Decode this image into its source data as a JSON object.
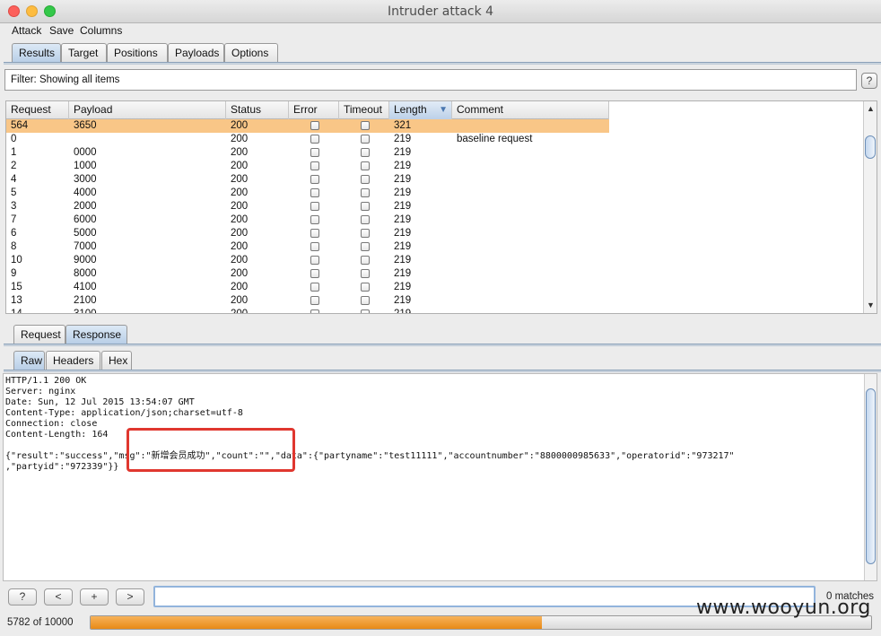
{
  "window": {
    "title": "Intruder attack 4"
  },
  "menu": [
    "Attack",
    "Save",
    "Columns"
  ],
  "main_tabs": [
    {
      "label": "Results",
      "active": true
    },
    {
      "label": "Target",
      "active": false
    },
    {
      "label": "Positions",
      "active": false
    },
    {
      "label": "Payloads",
      "active": false
    },
    {
      "label": "Options",
      "active": false
    }
  ],
  "filter": {
    "text": "Filter: Showing all items",
    "help_label": "?"
  },
  "results_table": {
    "columns": [
      "Request",
      "Payload",
      "Status",
      "Error",
      "Timeout",
      "Length",
      "Comment"
    ],
    "sorted_column": "Length",
    "sort_indicator": "▼",
    "rows": [
      {
        "request": "564",
        "payload": "3650",
        "status": "200",
        "length": "321",
        "comment": "",
        "selected": true
      },
      {
        "request": "0",
        "payload": "",
        "status": "200",
        "length": "219",
        "comment": "baseline request",
        "selected": false
      },
      {
        "request": "1",
        "payload": "0000",
        "status": "200",
        "length": "219",
        "comment": "",
        "selected": false
      },
      {
        "request": "2",
        "payload": "1000",
        "status": "200",
        "length": "219",
        "comment": "",
        "selected": false
      },
      {
        "request": "4",
        "payload": "3000",
        "status": "200",
        "length": "219",
        "comment": "",
        "selected": false
      },
      {
        "request": "5",
        "payload": "4000",
        "status": "200",
        "length": "219",
        "comment": "",
        "selected": false
      },
      {
        "request": "3",
        "payload": "2000",
        "status": "200",
        "length": "219",
        "comment": "",
        "selected": false
      },
      {
        "request": "7",
        "payload": "6000",
        "status": "200",
        "length": "219",
        "comment": "",
        "selected": false
      },
      {
        "request": "6",
        "payload": "5000",
        "status": "200",
        "length": "219",
        "comment": "",
        "selected": false
      },
      {
        "request": "8",
        "payload": "7000",
        "status": "200",
        "length": "219",
        "comment": "",
        "selected": false
      },
      {
        "request": "10",
        "payload": "9000",
        "status": "200",
        "length": "219",
        "comment": "",
        "selected": false
      },
      {
        "request": "9",
        "payload": "8000",
        "status": "200",
        "length": "219",
        "comment": "",
        "selected": false
      },
      {
        "request": "15",
        "payload": "4100",
        "status": "200",
        "length": "219",
        "comment": "",
        "selected": false
      },
      {
        "request": "13",
        "payload": "2100",
        "status": "200",
        "length": "219",
        "comment": "",
        "selected": false
      },
      {
        "request": "14",
        "payload": "3100",
        "status": "200",
        "length": "219",
        "comment": "",
        "selected": false
      }
    ]
  },
  "detail_tabs": [
    {
      "label": "Request",
      "active": false
    },
    {
      "label": "Response",
      "active": true
    }
  ],
  "view_tabs": [
    {
      "label": "Raw",
      "active": true
    },
    {
      "label": "Headers",
      "active": false
    },
    {
      "label": "Hex",
      "active": false
    }
  ],
  "response": {
    "text": "HTTP/1.1 200 OK\nServer: nginx\nDate: Sun, 12 Jul 2015 13:54:07 GMT\nContent-Type: application/json;charset=utf-8\nConnection: close\nContent-Length: 164\n\n{\"result\":\"success\",\"msg\":\"新增会员成功\",\"count\":\"\",\"data\":{\"partyname\":\"test11111\",\"accountnumber\":\"8800000985633\",\"operatorid\":\"973217\"\n,\"partyid\":\"972339\"}}"
  },
  "search_bar": {
    "buttons": [
      "?",
      "<",
      "+",
      ">"
    ],
    "input_value": "",
    "matches": "0 matches"
  },
  "progress": {
    "label": "5782 of 10000",
    "fraction": 0.5782
  },
  "watermark": "www.wooyun.org",
  "colors": {
    "selected_row": "#f9c687",
    "progress_fill": "#e98a17",
    "highlight_box": "#e0372f",
    "active_tab": "#b7cde6"
  }
}
